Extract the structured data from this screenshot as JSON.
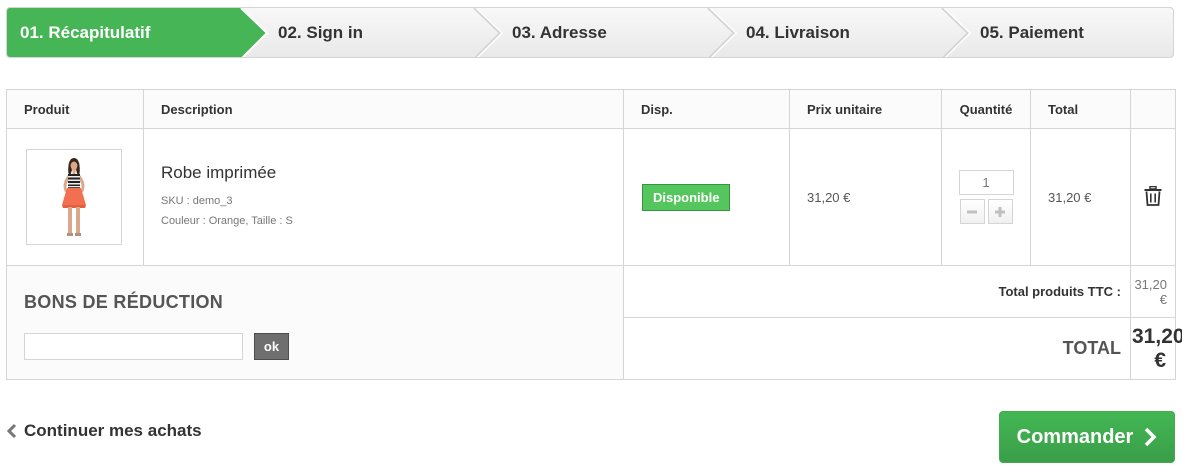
{
  "steps": [
    {
      "label": "01. Récapitulatif",
      "active": true
    },
    {
      "label": "02. Sign in",
      "active": false
    },
    {
      "label": "03. Adresse",
      "active": false
    },
    {
      "label": "04. Livraison",
      "active": false
    },
    {
      "label": "05. Paiement",
      "active": false
    }
  ],
  "table": {
    "headers": [
      "Produit",
      "Description",
      "Disp.",
      "Prix unitaire",
      "Quantité",
      "Total"
    ]
  },
  "item": {
    "name": "Robe imprimée",
    "sku": "SKU : demo_3",
    "attributes": "Couleur : Orange, Taille : S",
    "availability": "Disponible",
    "unit_price": "31,20 €",
    "quantity": "1",
    "total": "31,20 €",
    "image_icon": "dress-product-image",
    "delete_icon": "trash-icon"
  },
  "voucher": {
    "title": "BONS DE RÉDUCTION",
    "input_value": "",
    "ok_label": "ok"
  },
  "summary": {
    "products_label": "Total produits TTC :",
    "products_value": "31,20 €",
    "total_label": "TOTAL",
    "total_value": "31,20 €"
  },
  "actions": {
    "continue_label": "Continuer mes achats",
    "checkout_label": "Commander"
  },
  "colors": {
    "accent_green": "#43b754",
    "badge_green": "#55c65e",
    "border": "#d6d4d4"
  }
}
